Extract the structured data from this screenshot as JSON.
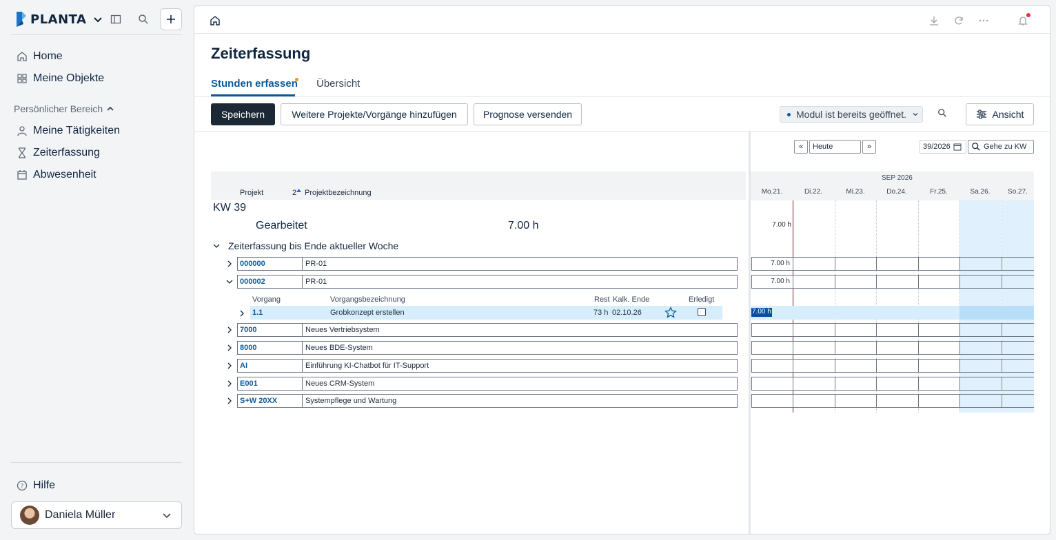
{
  "sidebar": {
    "brand": "PLANTA",
    "nav": [
      {
        "label": "Home",
        "icon": "home-icon"
      },
      {
        "label": "Meine Objekte",
        "icon": "grid-icon"
      }
    ],
    "section_label": "Persönlicher Bereich",
    "personal": [
      {
        "label": "Meine Tätigkeiten",
        "icon": "person-icon"
      },
      {
        "label": "Zeiterfassung",
        "icon": "hourglass-icon"
      },
      {
        "label": "Abwesenheit",
        "icon": "calendar-icon"
      }
    ],
    "help": "Hilfe",
    "user": "Daniela Müller"
  },
  "page": {
    "title": "Zeiterfassung",
    "tabs": [
      "Stunden erfassen",
      "Übersicht"
    ],
    "buttons": {
      "save": "Speichern",
      "add_projects": "Weitere Projekte/Vorgänge hinzufügen",
      "forecast": "Prognose versenden",
      "view": "Ansicht"
    },
    "module_status": "Modul ist bereits geöffnet."
  },
  "grid": {
    "headers": {
      "project": "Projekt",
      "sort_index": "2",
      "project_name": "Projektbezeichnung"
    },
    "week": "KW 39",
    "worked_label": "Gearbeitet",
    "worked_value": "7.00 h",
    "group_label": "Zeiterfassung bis Ende aktueller Woche",
    "projects": [
      {
        "id": "000000",
        "name": "PR-01"
      },
      {
        "id": "000002",
        "name": "PR-01"
      },
      {
        "id": "7000",
        "name": "Neues Vertriebsystem"
      },
      {
        "id": "8000",
        "name": "Neues BDE-System"
      },
      {
        "id": "AI",
        "name": "Einführung KI-Chatbot für IT-Support"
      },
      {
        "id": "E001",
        "name": "Neues CRM-System"
      },
      {
        "id": "S+W 20XX",
        "name": "Systempflege und Wartung"
      }
    ],
    "sub_headers": {
      "task": "Vorgang",
      "task_name": "Vorgangsbezeichnung",
      "rest": "Rest",
      "end": "Kalk. Ende",
      "done": "Erledigt"
    },
    "task": {
      "id": "1.1",
      "name": "Grobkonzept erstellen",
      "rest": "73 h",
      "end": "02.10.26"
    }
  },
  "calendar": {
    "prev": "«",
    "today": "Heute",
    "next": "»",
    "week_input": "39/2026",
    "goto": "Gehe zu KW",
    "month": "SEP 2026",
    "days": [
      "Mo.21.",
      "Di.22.",
      "Mi.23.",
      "Do.24.",
      "Fr.25.",
      "Sa.26.",
      "So.27."
    ],
    "worked_mon": "7.00 h",
    "row1_mon": "7.00 h",
    "row2_mon": "7.00 h",
    "task_mon": "7.00 h"
  }
}
